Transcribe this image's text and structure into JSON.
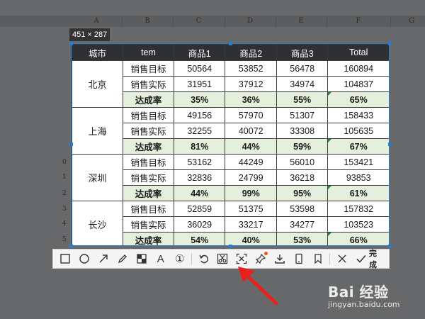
{
  "sheet": {
    "columns": [
      "A",
      "B",
      "C",
      "D",
      "E",
      "F",
      "G"
    ],
    "row_numbers": [
      "0",
      "1",
      "2",
      "3",
      "4",
      "5"
    ]
  },
  "selection_size": "451 × 287",
  "table": {
    "headers": [
      "城市",
      "tem",
      "商品1",
      "商品2",
      "商品3",
      "Total"
    ],
    "groups": [
      {
        "city": "北京",
        "rows": [
          {
            "metric": "销售目标",
            "values": [
              "50564",
              "53852",
              "56478",
              "160894"
            ]
          },
          {
            "metric": "销售实际",
            "values": [
              "31951",
              "37912",
              "34974",
              "104837"
            ]
          },
          {
            "metric": "达成率",
            "values": [
              "35%",
              "36%",
              "55%",
              "65%"
            ]
          }
        ]
      },
      {
        "city": "上海",
        "rows": [
          {
            "metric": "销售目标",
            "values": [
              "49156",
              "57970",
              "51307",
              "158433"
            ]
          },
          {
            "metric": "销售实际",
            "values": [
              "32255",
              "40072",
              "33308",
              "105635"
            ]
          },
          {
            "metric": "达成率",
            "values": [
              "81%",
              "44%",
              "59%",
              "67%"
            ]
          }
        ]
      },
      {
        "city": "深圳",
        "rows": [
          {
            "metric": "销售目标",
            "values": [
              "53162",
              "44249",
              "56010",
              "153421"
            ]
          },
          {
            "metric": "销售实际",
            "values": [
              "32836",
              "24799",
              "36218",
              "93853"
            ]
          },
          {
            "metric": "达成率",
            "values": [
              "44%",
              "99%",
              "95%",
              "61%"
            ]
          }
        ]
      },
      {
        "city": "长沙",
        "rows": [
          {
            "metric": "销售目标",
            "values": [
              "52859",
              "51375",
              "53598",
              "157832"
            ]
          },
          {
            "metric": "销售实际",
            "values": [
              "36029",
              "33217",
              "34277",
              "103523"
            ]
          },
          {
            "metric": "达成率",
            "values": [
              "54%",
              "40%",
              "53%",
              "66%"
            ]
          }
        ]
      }
    ]
  },
  "toolbar": {
    "tools": [
      {
        "name": "rectangle-tool",
        "icon": "rectangle-icon"
      },
      {
        "name": "ellipse-tool",
        "icon": "circle-icon"
      },
      {
        "name": "arrow-tool",
        "icon": "arrow-icon"
      },
      {
        "name": "pen-tool",
        "icon": "pencil-icon"
      },
      {
        "name": "mosaic-tool",
        "icon": "mosaic-icon"
      },
      {
        "name": "text-tool",
        "icon": "text-icon",
        "glyph": "A"
      },
      {
        "name": "number-tool",
        "icon": "number-icon",
        "glyph": "①"
      },
      {
        "name": "undo-button",
        "icon": "undo-icon"
      },
      {
        "name": "crop-tool",
        "icon": "scissors-icon"
      },
      {
        "name": "ocr-tool",
        "icon": "ocr-icon"
      },
      {
        "name": "pin-tool",
        "icon": "pin-icon"
      },
      {
        "name": "download-button",
        "icon": "download-icon"
      },
      {
        "name": "phone-tool",
        "icon": "phone-icon"
      },
      {
        "name": "bookmark-tool",
        "icon": "bookmark-icon"
      },
      {
        "name": "close-button",
        "icon": "close-icon"
      }
    ],
    "finish_label": "完成"
  },
  "watermark": {
    "brand": "Bai 经验",
    "url": "jingyan.baidu.com"
  },
  "colors": {
    "accent": "#2b7bd1",
    "rate_fill": "#e4f0dc",
    "annotation_arrow": "#e8211c"
  }
}
